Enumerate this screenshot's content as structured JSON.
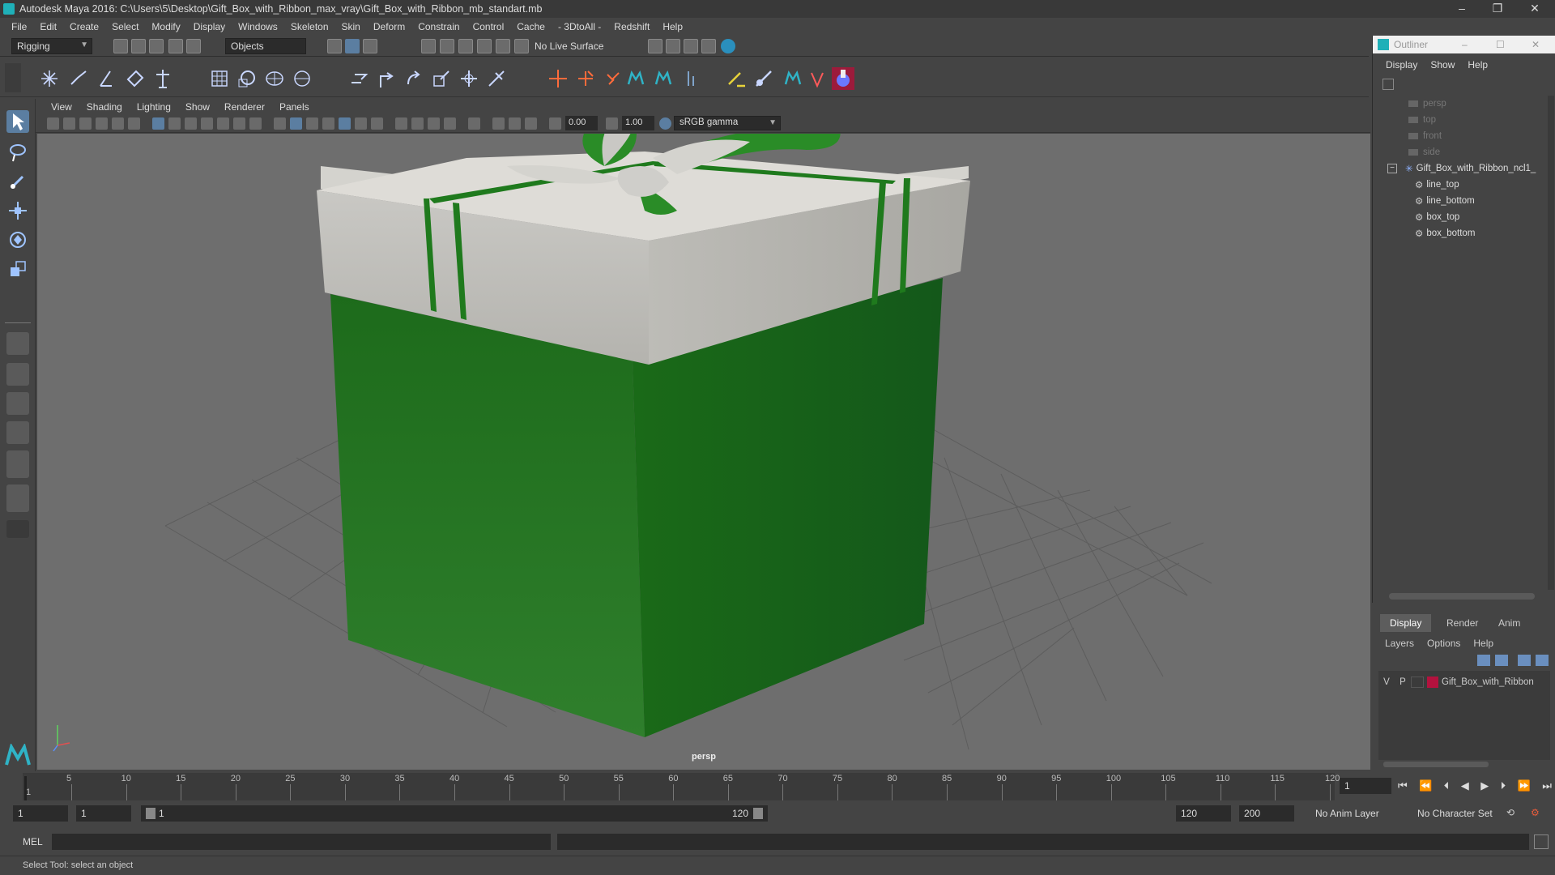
{
  "window": {
    "title": "Autodesk Maya 2016: C:\\Users\\5\\Desktop\\Gift_Box_with_Ribbon_max_vray\\Gift_Box_with_Ribbon_mb_standart.mb",
    "minimize": "–",
    "maximize": "❐",
    "close": "✕"
  },
  "menubar": [
    "File",
    "Edit",
    "Create",
    "Select",
    "Modify",
    "Display",
    "Windows",
    "Skeleton",
    "Skin",
    "Deform",
    "Constrain",
    "Control",
    "Cache",
    "- 3DtoAll -",
    "Redshift",
    "Help"
  ],
  "statusline": {
    "menuset": "Rigging",
    "selection_mode": "Objects",
    "live_surface": "No Live Surface"
  },
  "viewport": {
    "menu": [
      "View",
      "Shading",
      "Lighting",
      "Show",
      "Renderer",
      "Panels"
    ],
    "exposure": "0.00",
    "gamma": "1.00",
    "colorspace": "sRGB gamma",
    "camera_label": "persp"
  },
  "outliner": {
    "title": "Outliner",
    "menu": [
      "Display",
      "Show",
      "Help"
    ],
    "items": [
      {
        "label": "persp",
        "dim": true
      },
      {
        "label": "top",
        "dim": true
      },
      {
        "label": "front",
        "dim": true
      },
      {
        "label": "side",
        "dim": true
      },
      {
        "label": "Gift_Box_with_Ribbon_ncl1_",
        "dim": false
      },
      {
        "label": "line_top",
        "dim": false
      },
      {
        "label": "line_bottom",
        "dim": false
      },
      {
        "label": "box_top",
        "dim": false
      },
      {
        "label": "box_bottom",
        "dim": false
      }
    ],
    "collapse": "−"
  },
  "layers": {
    "tabs": [
      "Display",
      "Render",
      "Anim"
    ],
    "menu": [
      "Layers",
      "Options",
      "Help"
    ],
    "row": {
      "v": "V",
      "p": "P",
      "name": "Gift_Box_with_Ribbon",
      "color": "#b3123e"
    }
  },
  "timeline": {
    "ticks": [
      5,
      10,
      15,
      20,
      25,
      30,
      35,
      40,
      45,
      50,
      55,
      60,
      65,
      70,
      75,
      80,
      85,
      90,
      95,
      100,
      105,
      110,
      115,
      120
    ],
    "start_marker": "1",
    "current_frame": "1"
  },
  "range": {
    "start": "1",
    "start_inner": "1",
    "slider_start": "1",
    "slider_end": "120",
    "end_inner": "120",
    "end": "200",
    "anim_layer": "No Anim Layer",
    "character_set": "No Character Set"
  },
  "cmdline": {
    "label": "MEL"
  },
  "helpline": {
    "text": "Select Tool: select an object"
  }
}
